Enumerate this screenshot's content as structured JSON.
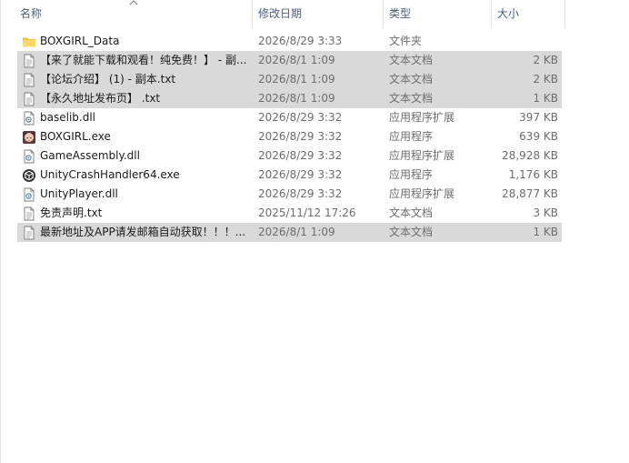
{
  "columns": {
    "name": "名称",
    "date": "修改日期",
    "type": "类型",
    "size": "大小"
  },
  "files": [
    {
      "name": "BOXGIRL_Data",
      "date": "2026/8/29 3:33",
      "type": "文件夹",
      "size": "",
      "icon": "folder-icon",
      "selected": false
    },
    {
      "name": "【来了就能下载和观看！纯免费！】 - 副...",
      "date": "2026/8/1 1:09",
      "type": "文本文档",
      "size": "2 KB",
      "icon": "text-file-icon",
      "selected": true
    },
    {
      "name": "【论坛介绍】 (1) - 副本.txt",
      "date": "2026/8/1 1:09",
      "type": "文本文档",
      "size": "2 KB",
      "icon": "text-file-icon",
      "selected": true
    },
    {
      "name": "【永久地址发布页】 .txt",
      "date": "2026/8/1 1:09",
      "type": "文本文档",
      "size": "1 KB",
      "icon": "text-file-icon",
      "selected": true
    },
    {
      "name": "baselib.dll",
      "date": "2026/8/29 3:32",
      "type": "应用程序扩展",
      "size": "397 KB",
      "icon": "dll-file-icon",
      "selected": false
    },
    {
      "name": "BOXGIRL.exe",
      "date": "2026/8/29 3:32",
      "type": "应用程序",
      "size": "639 KB",
      "icon": "game-exe-icon",
      "selected": false
    },
    {
      "name": "GameAssembly.dll",
      "date": "2026/8/29 3:32",
      "type": "应用程序扩展",
      "size": "28,928 KB",
      "icon": "dll-file-icon",
      "selected": false
    },
    {
      "name": "UnityCrashHandler64.exe",
      "date": "2026/8/29 3:32",
      "type": "应用程序",
      "size": "1,176 KB",
      "icon": "unity-exe-icon",
      "selected": false
    },
    {
      "name": "UnityPlayer.dll",
      "date": "2026/8/29 3:32",
      "type": "应用程序扩展",
      "size": "28,877 KB",
      "icon": "dll-file-icon",
      "selected": false
    },
    {
      "name": "免责声明.txt",
      "date": "2025/11/12 17:26",
      "type": "文本文档",
      "size": "3 KB",
      "icon": "text-file-icon",
      "selected": false
    },
    {
      "name": "最新地址及APP请发邮箱自动获取！！！...",
      "date": "2026/8/1 1:09",
      "type": "文本文档",
      "size": "1 KB",
      "icon": "text-file-icon",
      "selected": true
    }
  ]
}
